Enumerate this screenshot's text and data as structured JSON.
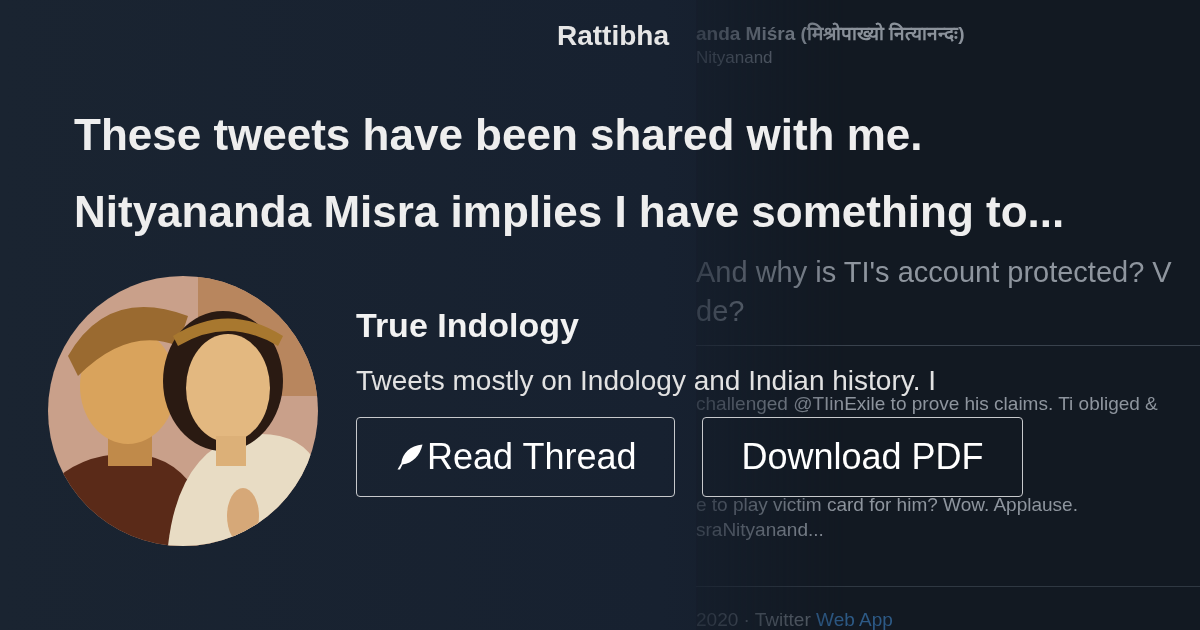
{
  "brand": "Rattibha",
  "title": "These tweets have been shared with me. Nityananda Misra implies I have something to...",
  "profile": {
    "name": "True Indology",
    "bio": "Tweets mostly on Indology and Indian history. I"
  },
  "buttons": [
    {
      "label": "Read Thread",
      "kind": "feather"
    },
    {
      "label": "Download PDF",
      "kind": "plain"
    }
  ],
  "background_tweet": {
    "author": "anda Miśra (मिश्रोपाख्यो नित्यानन्दः)",
    "handle": "Nityanand",
    "body_lines": [
      "And why is TI's account protected? V",
      "de?"
    ],
    "reply_lines": [
      "challenged @TIinExile to prove his claims. Ti obliged &",
      "e to play victim card for him? Wow. Applause.",
      "sraNityanand..."
    ],
    "footer": {
      "date": "2020 · Twitter",
      "source": "Web App"
    }
  }
}
